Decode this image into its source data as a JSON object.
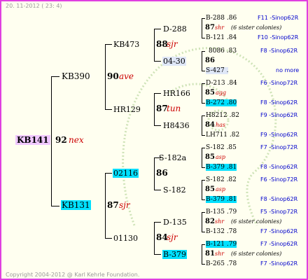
{
  "header": "20. 11-2012 ( 23: 4)",
  "footer": "Copyright 2004-2012 @ Karl Kehrle Foundation.",
  "colors": {
    "frame": "#e040e0",
    "highlight_cyan": "#00e0ff",
    "highlight_pink": "#f0c8ff",
    "line_text": "#0000cc",
    "breeder": "#cc0000"
  },
  "root": {
    "id": "KB141",
    "year": "92",
    "breeder": "nex"
  },
  "gen1": [
    {
      "id": "KB390",
      "year": "90",
      "breeder": "ave"
    },
    {
      "id": "KB131",
      "year": "87",
      "breeder": "sjr"
    }
  ],
  "gen2": [
    {
      "id": "KB473",
      "year": "88",
      "breeder": "sjr"
    },
    {
      "id": "HR129",
      "year": "87",
      "breeder": "tun"
    },
    {
      "id": "02116",
      "year": "86",
      "breeder": ""
    },
    {
      "id": "01130",
      "year": "84",
      "breeder": "sjr"
    }
  ],
  "gen3": [
    {
      "id": "D-288",
      "year": "87",
      "breeder": "shr",
      "note": "(6 sister colonies)"
    },
    {
      "id": "04-30",
      "year": "86",
      "breeder": "",
      "note": ""
    },
    {
      "id": "HR166",
      "year": "85",
      "breeder": "agg",
      "note": ""
    },
    {
      "id": "H8436",
      "year": "84",
      "breeder": "has",
      "note": ""
    },
    {
      "id": "S-182a",
      "year": "85",
      "breeder": "asp",
      "note": ""
    },
    {
      "id": "S-182",
      "year": "85",
      "breeder": "asp",
      "note": ""
    },
    {
      "id": "D-135",
      "year": "82",
      "breeder": "shr",
      "note": "(6 sister colonies)"
    },
    {
      "id": "B-379",
      "year": "81",
      "breeder": "shr",
      "note": "(6 sister colonies)"
    }
  ],
  "gen4": [
    {
      "id": "B-288 .86",
      "line": "F11 -Sinop62R"
    },
    {
      "id": "B-121 .84",
      "line": "F10 -Sinop62R"
    },
    {
      "id": "8086 .83",
      "line": "F8 -Sinop62R"
    },
    {
      "id": "S-427 .",
      "line": "no more"
    },
    {
      "id": "D-213 .84",
      "line": "F6 -Sinop72R"
    },
    {
      "id": "B-272 .80",
      "line": "F8 -Sinop62R"
    },
    {
      "id": "H8212 .82",
      "line": "F9 -Sinop62R"
    },
    {
      "id": "LH711 .82",
      "line": "F9 -Sinop62R"
    },
    {
      "id": "S-182 .85",
      "line": "F7 -Sinop72R"
    },
    {
      "id": "B-379 .81",
      "line": "F8 -Sinop62R"
    },
    {
      "id": "S-182 .82",
      "line": "F6 -Sinop72R"
    },
    {
      "id": "B-379 .81",
      "line": "F8 -Sinop62R"
    },
    {
      "id": "B-135 .79",
      "line": "F5 -Sinop72R"
    },
    {
      "id": "B-132 .78",
      "line": "F7 -Sinop62R"
    },
    {
      "id": "B-121 .79",
      "line": "F7 -Sinop62R"
    },
    {
      "id": "B-265 .78",
      "line": "F7 -Sinop62R"
    }
  ]
}
